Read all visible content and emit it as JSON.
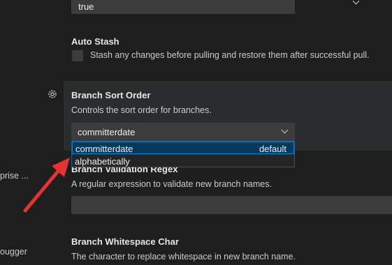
{
  "sidebar": {
    "fragments": [
      "prise ...",
      "ougger"
    ]
  },
  "settings": {
    "top_select_value": "true",
    "auto_stash": {
      "title": "Auto Stash",
      "description": "Stash any changes before pulling and restore them after successful pull."
    },
    "branch_sort_order": {
      "title": "Branch Sort Order",
      "description": "Controls the sort order for branches.",
      "selected_value": "committerdate",
      "options": [
        {
          "label": "committerdate",
          "tag": "default"
        },
        {
          "label": "alphabetically",
          "tag": ""
        }
      ]
    },
    "branch_validation_regex": {
      "title": "Branch Validation Regex",
      "description": "A regular expression to validate new branch names."
    },
    "branch_whitespace_char": {
      "title": "Branch Whitespace Char",
      "description": "The character to replace whitespace in new branch name."
    }
  },
  "colors": {
    "annotation_arrow": "#e8322f",
    "focus_border": "#007fd4"
  }
}
